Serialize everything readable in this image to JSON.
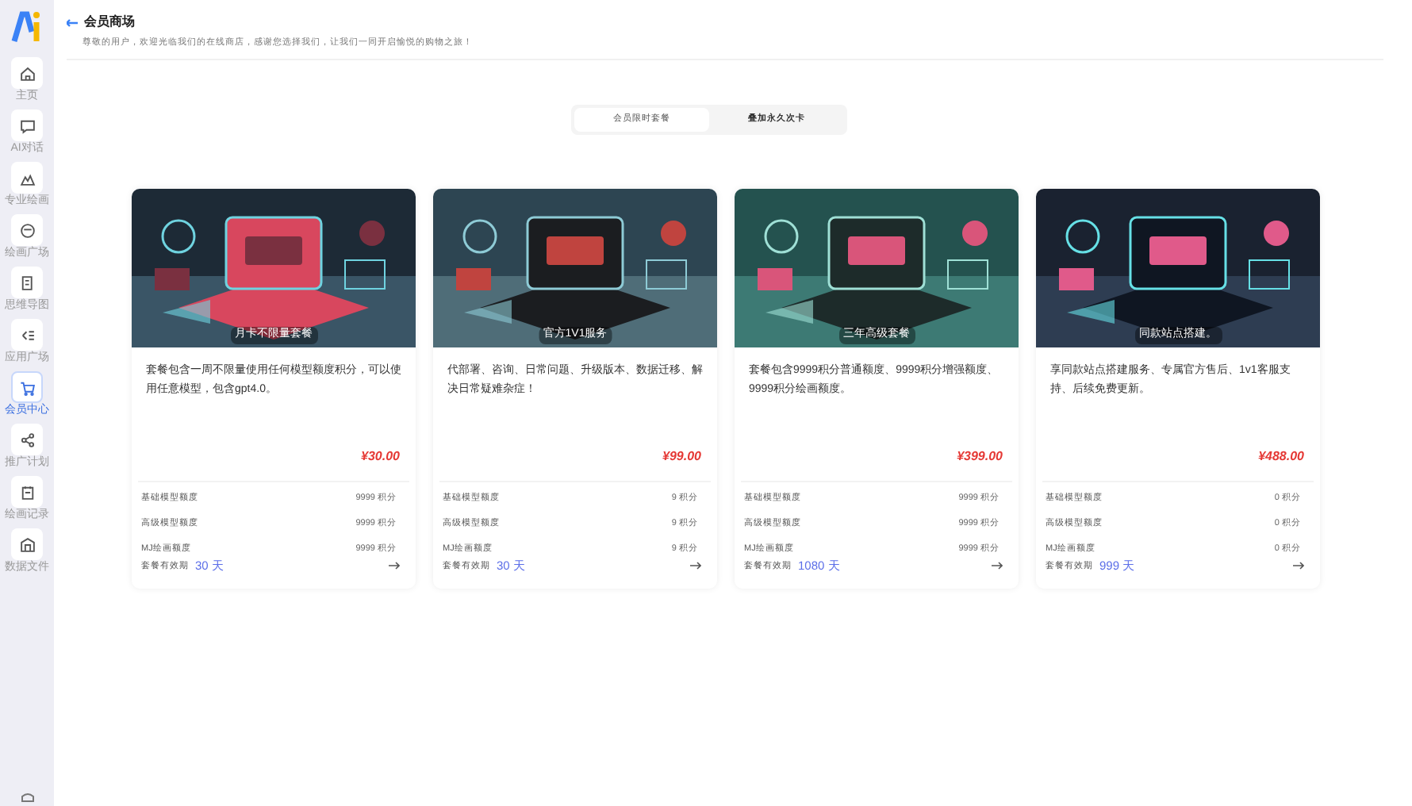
{
  "sidebar": {
    "items": [
      {
        "label": "主页",
        "selected": false
      },
      {
        "label": "AI对话",
        "selected": false
      },
      {
        "label": "专业绘画",
        "selected": false
      },
      {
        "label": "绘画广场",
        "selected": false
      },
      {
        "label": "思维导图",
        "selected": false
      },
      {
        "label": "应用广场",
        "selected": false
      },
      {
        "label": "会员中心",
        "selected": true
      },
      {
        "label": "推广计划",
        "selected": false
      },
      {
        "label": "绘画记录",
        "selected": false
      },
      {
        "label": "数据文件",
        "selected": false
      }
    ]
  },
  "header": {
    "title": "会员商场",
    "subtitle": "尊敬的用户，欢迎光临我们的在线商店，感谢您选择我们，让我们一同开启愉悦的购物之旅！"
  },
  "tabs": [
    {
      "label": "会员限时套餐",
      "selected": true
    },
    {
      "label": "叠加永久次卡",
      "selected": false
    }
  ],
  "cards": [
    {
      "caption": "月卡不限量套餐",
      "description": "套餐包含一周不限量使用任何模型额度积分，可以使用任意模型，包含gpt4.0。",
      "price": "¥30.00",
      "quotas": [
        {
          "label": "基础模型额度",
          "value": "9999 积分"
        },
        {
          "label": "高级模型额度",
          "value": "9999 积分"
        },
        {
          "label": "MJ绘画额度",
          "value": "9999 积分"
        }
      ],
      "validity_label": "套餐有效期",
      "validity": "30 天"
    },
    {
      "caption": "官方1V1服务",
      "description": "代部署、咨询、日常问题、升级版本、数据迁移、解决日常疑难杂症！",
      "price": "¥99.00",
      "quotas": [
        {
          "label": "基础模型额度",
          "value": "9 积分"
        },
        {
          "label": "高级模型额度",
          "value": "9 积分"
        },
        {
          "label": "MJ绘画额度",
          "value": "9 积分"
        }
      ],
      "validity_label": "套餐有效期",
      "validity": "30 天"
    },
    {
      "caption": "三年高级套餐",
      "description": "套餐包含9999积分普通额度、9999积分增强额度、9999积分绘画额度。",
      "price": "¥399.00",
      "quotas": [
        {
          "label": "基础模型额度",
          "value": "9999 积分"
        },
        {
          "label": "高级模型额度",
          "value": "9999 积分"
        },
        {
          "label": "MJ绘画额度",
          "value": "9999 积分"
        }
      ],
      "validity_label": "套餐有效期",
      "validity": "1080 天"
    },
    {
      "caption": "同款站点搭建。",
      "description": "享同款站点搭建服务、专属官方售后、1v1客服支持、后续免费更新。",
      "price": "¥488.00",
      "quotas": [
        {
          "label": "基础模型额度",
          "value": "0 积分"
        },
        {
          "label": "高级模型额度",
          "value": "0 积分"
        },
        {
          "label": "MJ绘画额度",
          "value": "0 积分"
        }
      ],
      "validity_label": "套餐有效期",
      "validity": "999 天"
    }
  ]
}
